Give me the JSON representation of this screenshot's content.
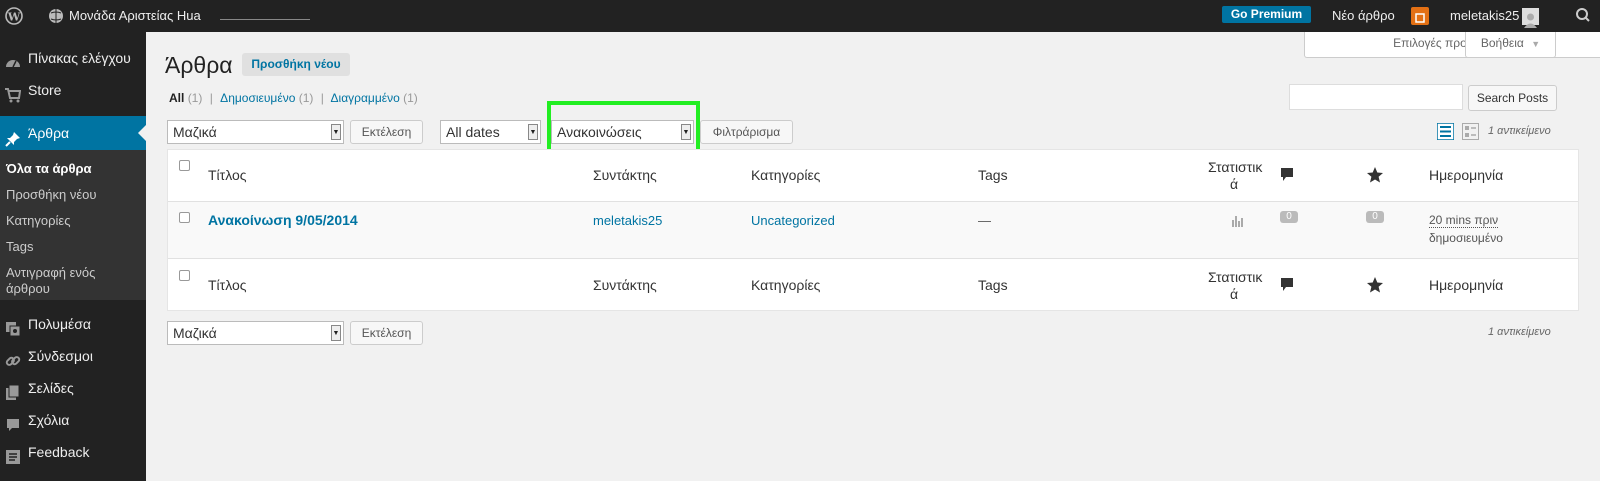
{
  "adminbar": {
    "site_name": "Μονάδα Αριστείας Hua",
    "go_premium": "Go Premium",
    "new_post": "Νέο άρθρο",
    "username": "meletakis25"
  },
  "sidebar": {
    "menu": [
      {
        "label": "Πίνακας ελέγχου",
        "icon": "dashboard-icon"
      },
      {
        "label": "Store",
        "icon": "cart-icon"
      },
      {
        "label": "Άρθρα",
        "icon": "pushpin-icon"
      },
      {
        "label": "Πολυμέσα",
        "icon": "media-icon"
      },
      {
        "label": "Σύνδεσμοι",
        "icon": "link-icon"
      },
      {
        "label": "Σελίδες",
        "icon": "pages-icon"
      },
      {
        "label": "Σχόλια",
        "icon": "comment-icon"
      },
      {
        "label": "Feedback",
        "icon": "feedback-icon"
      }
    ],
    "submenu": [
      "Όλα τα άρθρα",
      "Προσθήκη νέου",
      "Κατηγορίες",
      "Tags",
      "Αντιγραφή ενός",
      "άρθρου"
    ]
  },
  "screen_options": "Επιλογές προβολής",
  "help": "Βοήθεια",
  "page": {
    "title": "Άρθρα",
    "add_new": "Προσθήκη νέου"
  },
  "filters": {
    "all": "All",
    "all_count": "(1)",
    "published": "Δημοσιευμένο",
    "published_count": "(1)",
    "trash": "Διαγραμμένο",
    "trash_count": "(1)",
    "sep": "|"
  },
  "search": {
    "button": "Search Posts",
    "value": ""
  },
  "tablenav": {
    "bulk_select": "Μαζικά",
    "apply": "Εκτέλεση",
    "dates": "All dates",
    "category": "Ανακοινώσεις",
    "filter": "Φιλτράρισμα",
    "count": "1 αντικείμενο"
  },
  "columns": {
    "title": "Τίτλος",
    "author": "Συντάκτης",
    "categories": "Κατηγορίες",
    "tags": "Tags",
    "stats_1": "Στατιστικ",
    "stats_2": "ά",
    "date": "Ημερομηνία"
  },
  "row": {
    "title": "Ανακοίνωση 9/05/2014",
    "author": "meletakis25",
    "category": "Uncategorized",
    "tags": "—",
    "comments": "0",
    "likes": "0",
    "date": "20 mins πριν",
    "status": "δημοσιευμένο"
  },
  "colors": {
    "adminbar": "#222222",
    "accent": "#0074a2",
    "highlight": "#22ee22",
    "premium": "#0074a2"
  }
}
